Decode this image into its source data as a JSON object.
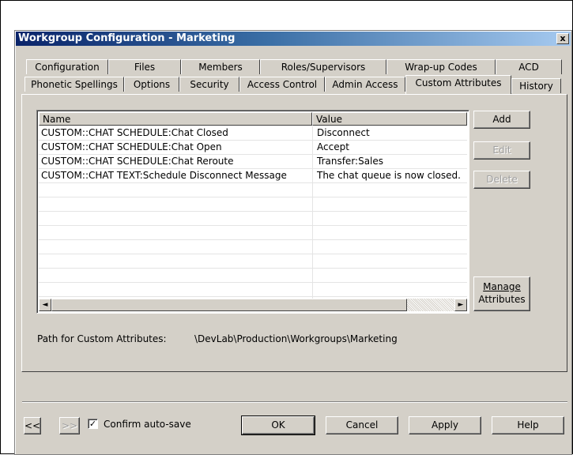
{
  "window": {
    "title": "Workgroup Configuration - Marketing",
    "close_glyph": "x"
  },
  "tabs": {
    "row1": [
      "Configuration",
      "Files",
      "Members",
      "Roles/Supervisors",
      "Wrap-up Codes",
      "ACD"
    ],
    "row2": [
      "Phonetic Spellings",
      "Options",
      "Security",
      "Access Control",
      "Admin Access",
      "Custom Attributes",
      "History"
    ],
    "active": "Custom Attributes"
  },
  "attributes_list": {
    "columns": [
      "Name",
      "Value"
    ],
    "rows": [
      {
        "name": "CUSTOM::CHAT SCHEDULE:Chat Closed",
        "value": "Disconnect"
      },
      {
        "name": "CUSTOM::CHAT SCHEDULE:Chat Open",
        "value": "Accept"
      },
      {
        "name": "CUSTOM::CHAT SCHEDULE:Chat Reroute",
        "value": "Transfer:Sales"
      },
      {
        "name": "CUSTOM::CHAT TEXT:Schedule Disconnect Message",
        "value": "The chat queue is now closed."
      }
    ],
    "scroll_left": "◄",
    "scroll_right": "►"
  },
  "side_buttons": {
    "add": "Add",
    "edit": "Edit",
    "delete": "Delete",
    "manage_line1": "Manage",
    "manage_line2": "Attributes"
  },
  "path": {
    "label": "Path for Custom Attributes:",
    "value": "\\DevLab\\Production\\Workgroups\\Marketing"
  },
  "footer": {
    "prev": "<<",
    "next": ">>",
    "confirm_label": "Confirm auto-save",
    "confirm_checked": "✓",
    "ok": "OK",
    "cancel": "Cancel",
    "apply": "Apply",
    "help": "Help"
  }
}
